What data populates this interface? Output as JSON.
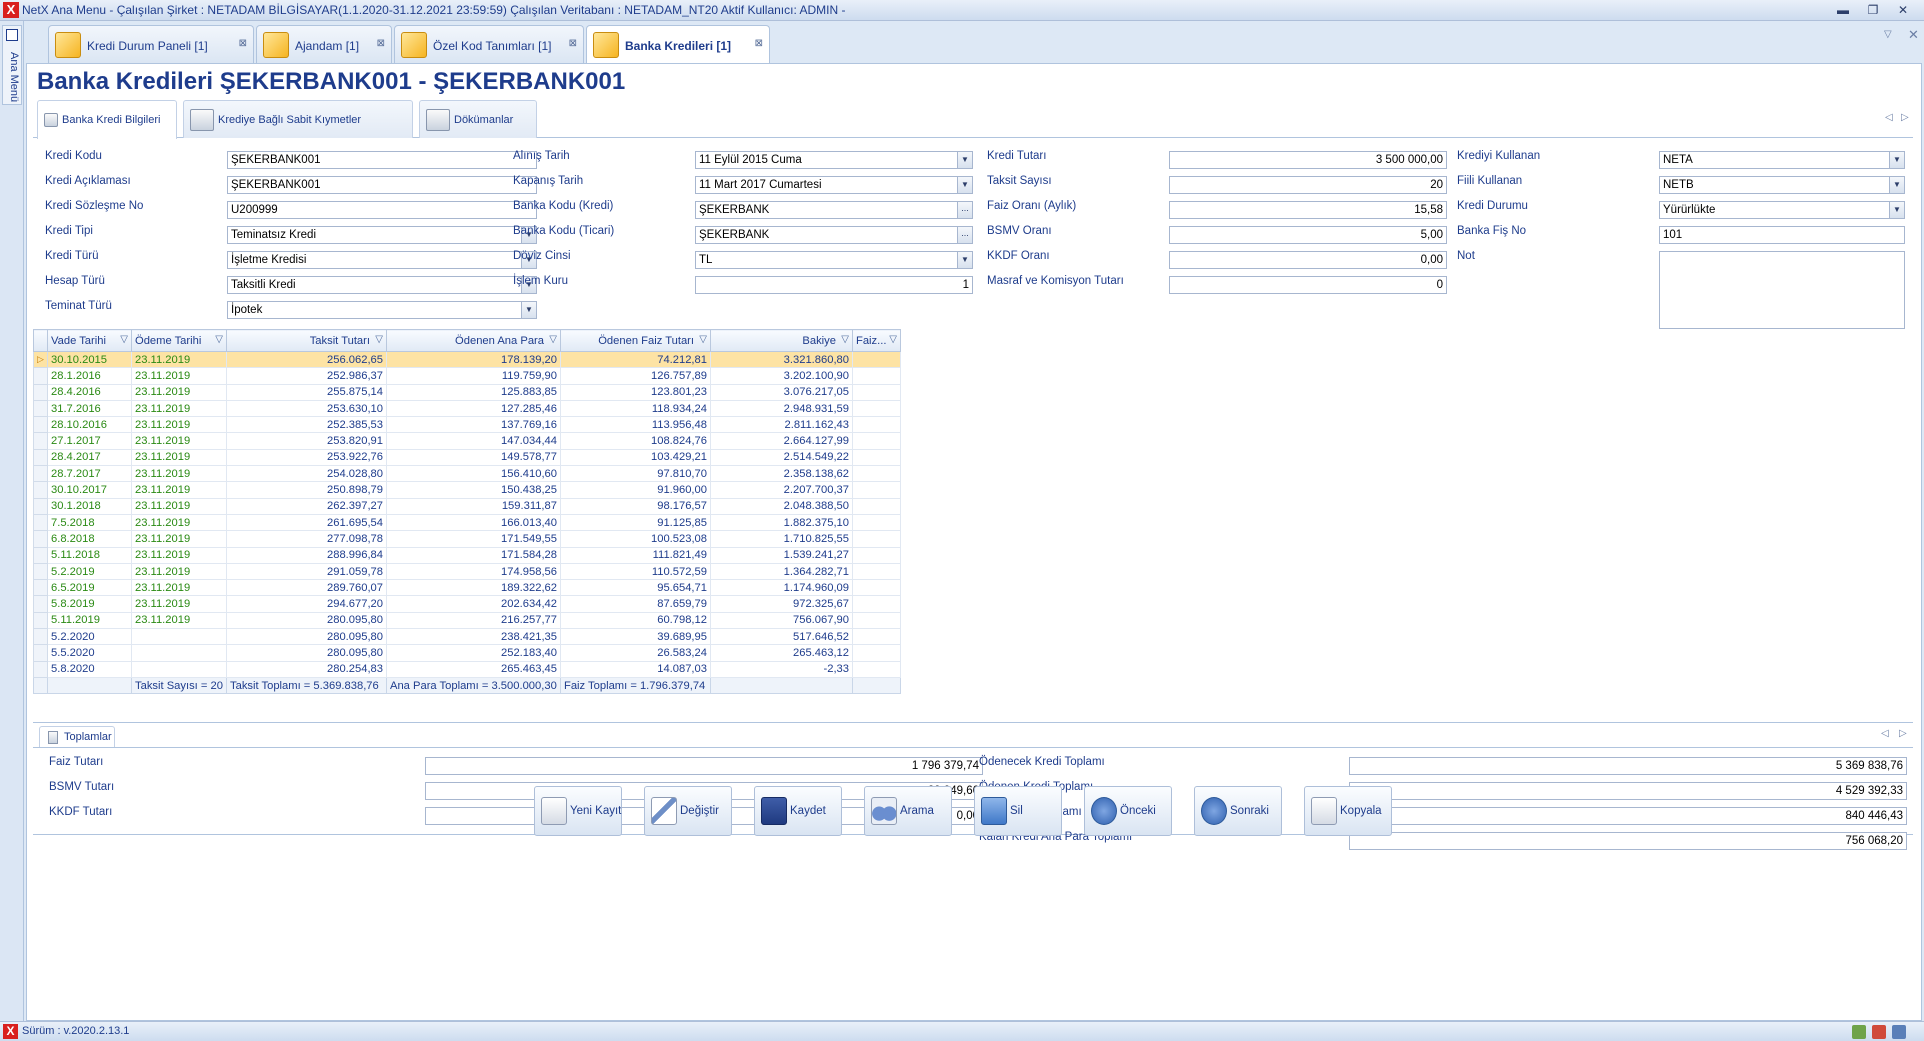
{
  "window": {
    "title": "NetX Ana Menu - Çalışılan Şirket : NETADAM BİLGİSAYAR(1.1.2020-31.12.2021 23:59:59) Çalışılan Veritabanı : NETADAM_NT20  Aktif Kullanıcı: ADMIN -",
    "app_icon": "X"
  },
  "left_rail": {
    "label": "Ana Menü"
  },
  "doc_tabs": [
    {
      "label": "Kredi Durum Paneli [1]"
    },
    {
      "label": "Ajandam [1]"
    },
    {
      "label": "Özel Kod Tanımları [1]"
    },
    {
      "label": "Banka Kredileri [1]"
    }
  ],
  "page_title": "Banka Kredileri ŞEKERBANK001 - ŞEKERBANK001",
  "sub_tabs": [
    {
      "label": "Banka Kredi Bilgileri"
    },
    {
      "label": "Krediye Bağlı Sabit Kıymetler"
    },
    {
      "label": "Dökümanlar"
    }
  ],
  "form": {
    "kredi_kodu": {
      "label": "Kredi Kodu",
      "value": "ŞEKERBANK001"
    },
    "kredi_aciklamasi": {
      "label": "Kredi Açıklaması",
      "value": "ŞEKERBANK001"
    },
    "kredi_sozlesme_no": {
      "label": "Kredi Sözleşme No",
      "value": "U200999"
    },
    "kredi_tipi": {
      "label": "Kredi Tipi",
      "value": "Teminatsız Kredi"
    },
    "kredi_turu": {
      "label": "Kredi Türü",
      "value": "İşletme Kredisi"
    },
    "hesap_turu": {
      "label": "Hesap Türü",
      "value": "Taksitli Kredi"
    },
    "teminat_turu": {
      "label": "Teminat Türü",
      "value": "İpotek"
    },
    "alinis_tarih": {
      "label": "Alınış Tarih",
      "value": "11 Eylül 2015 Cuma"
    },
    "kapanis_tarih": {
      "label": "Kapanış Tarih",
      "value": "11 Mart 2017 Cumartesi"
    },
    "banka_kodu_kredi": {
      "label": "Banka Kodu (Kredi)",
      "value": "ŞEKERBANK"
    },
    "banka_kodu_ticari": {
      "label": "Banka Kodu (Ticari)",
      "value": "ŞEKERBANK"
    },
    "doviz_cinsi": {
      "label": "Döviz Cinsi",
      "value": "TL"
    },
    "islem_kuru": {
      "label": "İşlem Kuru",
      "value": "1"
    },
    "kredi_tutari": {
      "label": "Kredi Tutarı",
      "value": "3 500 000,00"
    },
    "taksit_sayisi": {
      "label": "Taksit Sayısı",
      "value": "20"
    },
    "faiz_orani": {
      "label": "Faiz Oranı (Aylık)",
      "value": "15,58"
    },
    "bsmv_orani": {
      "label": "BSMV Oranı",
      "value": "5,00"
    },
    "kkdf_orani": {
      "label": "KKDF Oranı",
      "value": "0,00"
    },
    "masraf": {
      "label": "Masraf ve Komisyon Tutarı",
      "value": "0"
    },
    "krediyi_kullanan": {
      "label": "Krediyi Kullanan",
      "value": "NETA"
    },
    "fiili_kullanan": {
      "label": "Fiili Kullanan",
      "value": "NETB"
    },
    "kredi_durumu": {
      "label": "Kredi Durumu",
      "value": "Yürürlükte"
    },
    "banka_fis_no": {
      "label": "Banka Fiş No",
      "value": "101"
    },
    "not": {
      "label": "Not",
      "value": ""
    }
  },
  "grid": {
    "columns": [
      "Vade Tarihi",
      "Ödeme Tarihi",
      "Taksit Tutarı",
      "Ödenen Ana Para",
      "Ödenen Faiz Tutarı",
      "Bakiye",
      "Faiz..."
    ],
    "rows": [
      [
        "30.10.2015",
        "23.11.2019",
        "256.062,65",
        "178.139,20",
        "74.212,81",
        "3.321.860,80",
        ""
      ],
      [
        "28.1.2016",
        "23.11.2019",
        "252.986,37",
        "119.759,90",
        "126.757,89",
        "3.202.100,90",
        ""
      ],
      [
        "28.4.2016",
        "23.11.2019",
        "255.875,14",
        "125.883,85",
        "123.801,23",
        "3.076.217,05",
        ""
      ],
      [
        "31.7.2016",
        "23.11.2019",
        "253.630,10",
        "127.285,46",
        "118.934,24",
        "2.948.931,59",
        ""
      ],
      [
        "28.10.2016",
        "23.11.2019",
        "252.385,53",
        "137.769,16",
        "113.956,48",
        "2.811.162,43",
        ""
      ],
      [
        "27.1.2017",
        "23.11.2019",
        "253.820,91",
        "147.034,44",
        "108.824,76",
        "2.664.127,99",
        ""
      ],
      [
        "28.4.2017",
        "23.11.2019",
        "253.922,76",
        "149.578,77",
        "103.429,21",
        "2.514.549,22",
        ""
      ],
      [
        "28.7.2017",
        "23.11.2019",
        "254.028,80",
        "156.410,60",
        "97.810,70",
        "2.358.138,62",
        ""
      ],
      [
        "30.10.2017",
        "23.11.2019",
        "250.898,79",
        "150.438,25",
        "91.960,00",
        "2.207.700,37",
        ""
      ],
      [
        "30.1.2018",
        "23.11.2019",
        "262.397,27",
        "159.311,87",
        "98.176,57",
        "2.048.388,50",
        ""
      ],
      [
        "7.5.2018",
        "23.11.2019",
        "261.695,54",
        "166.013,40",
        "91.125,85",
        "1.882.375,10",
        ""
      ],
      [
        "6.8.2018",
        "23.11.2019",
        "277.098,78",
        "171.549,55",
        "100.523,08",
        "1.710.825,55",
        ""
      ],
      [
        "5.11.2018",
        "23.11.2019",
        "288.996,84",
        "171.584,28",
        "111.821,49",
        "1.539.241,27",
        ""
      ],
      [
        "5.2.2019",
        "23.11.2019",
        "291.059,78",
        "174.958,56",
        "110.572,59",
        "1.364.282,71",
        ""
      ],
      [
        "6.5.2019",
        "23.11.2019",
        "289.760,07",
        "189.322,62",
        "95.654,71",
        "1.174.960,09",
        ""
      ],
      [
        "5.8.2019",
        "23.11.2019",
        "294.677,20",
        "202.634,42",
        "87.659,79",
        "972.325,67",
        ""
      ],
      [
        "5.11.2019",
        "23.11.2019",
        "280.095,80",
        "216.257,77",
        "60.798,12",
        "756.067,90",
        ""
      ],
      [
        "5.2.2020",
        "",
        "280.095,80",
        "238.421,35",
        "39.689,95",
        "517.646,52",
        ""
      ],
      [
        "5.5.2020",
        "",
        "280.095,80",
        "252.183,40",
        "26.583,24",
        "265.463,12",
        ""
      ],
      [
        "5.8.2020",
        "",
        "280.254,83",
        "265.463,45",
        "14.087,03",
        "-2,33",
        ""
      ]
    ],
    "footer": [
      "",
      "Taksit Sayısı = 20",
      "Taksit Toplamı = 5.369.838,76",
      "Ana Para Toplamı = 3.500.000,30",
      "Faiz Toplamı = 1.796.379,74",
      "",
      ""
    ]
  },
  "totals": {
    "tab_label": "Toplamlar",
    "faiz_tutari": {
      "label": "Faiz Tutarı",
      "value": "1 796 379,74"
    },
    "bsmv_tutari": {
      "label": "BSMV Tutarı",
      "value": "89 949,66"
    },
    "kkdf_tutari": {
      "label": "KKDF Tutarı",
      "value": "0,00"
    },
    "odenecek_kredi": {
      "label": "Ödenecek Kredi Toplamı",
      "value": "5 369 838,76"
    },
    "odenen_kredi": {
      "label": "Ödenen Kredi Toplamı",
      "value": "4 529 392,33"
    },
    "kalan_kredi": {
      "label": "Kalan Kredi Toplamı",
      "value": "840 446,43"
    },
    "kalan_ana_para": {
      "label": "Kalan Kredi Ana Para Toplamı",
      "value": "756 068,20"
    }
  },
  "buttons": [
    {
      "label": "Yeni Kayıt",
      "icon": "new-document-icon"
    },
    {
      "label": "Değiştir",
      "icon": "edit-pencil-icon"
    },
    {
      "label": "Kaydet",
      "icon": "save-disk-icon"
    },
    {
      "label": "Arama",
      "icon": "binoculars-icon"
    },
    {
      "label": "Sil",
      "icon": "delete-icon"
    },
    {
      "label": "Önceki",
      "icon": "previous-icon"
    },
    {
      "label": "Sonraki",
      "icon": "next-icon"
    },
    {
      "label": "Kopyala",
      "icon": "copy-icon"
    }
  ],
  "status": {
    "version": "Sürüm : v.2020.2.13.1"
  },
  "colors": {
    "title_text": "#1e3c8c",
    "selected_row": "#fde3a4",
    "paid_date_green": "#2a8a14",
    "app_red": "#d9201e",
    "panel_bg": "#dde8f5"
  }
}
